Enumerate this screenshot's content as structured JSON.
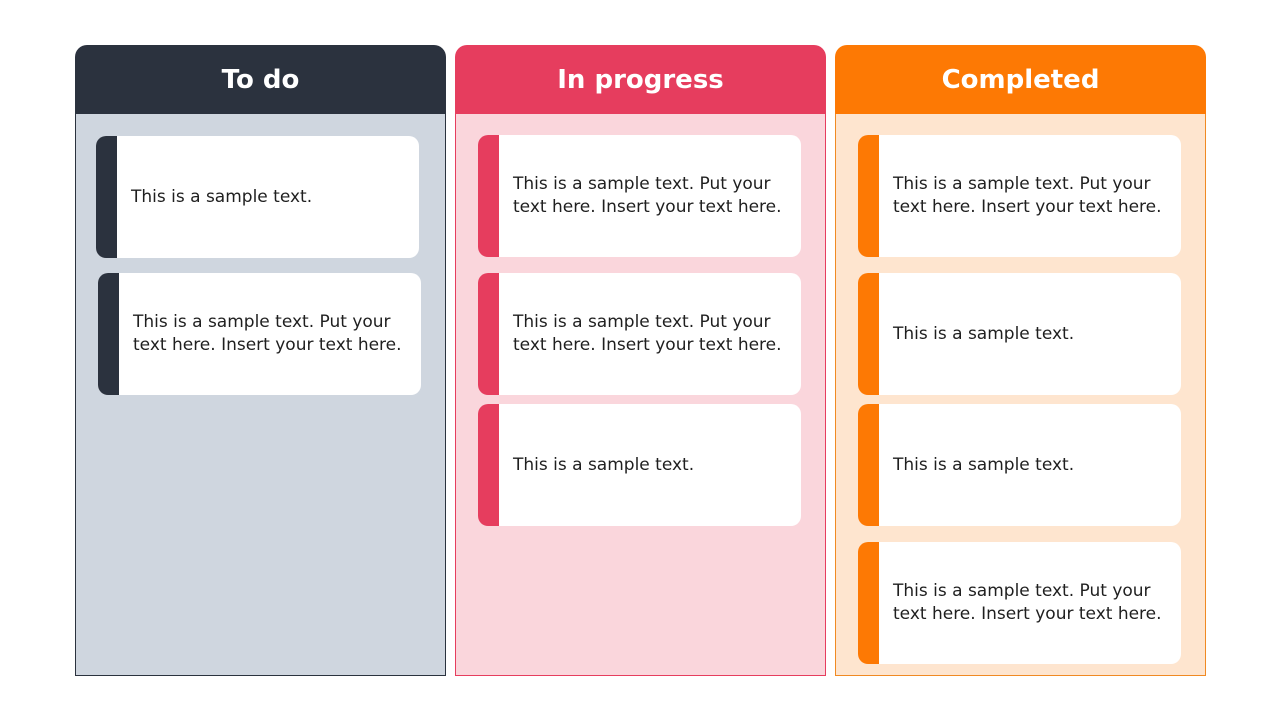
{
  "colors": {
    "todo_header": "#2b323e",
    "todo_body": "#cfd6df",
    "todo_border": "#2b323e",
    "inprogress_header": "#e63d5e",
    "inprogress_body": "#fad6dc",
    "inprogress_border": "#e63d5e",
    "completed_header": "#fd7904",
    "completed_body": "#fee5cf",
    "completed_border": "#f08a23"
  },
  "columns": [
    {
      "title": "To do",
      "cards": [
        {
          "text": "This is a sample text."
        },
        {
          "text": "This is a sample text. Put your text here. Insert your text here."
        }
      ]
    },
    {
      "title": "In progress",
      "cards": [
        {
          "text": "This is a sample text. Put your text here. Insert your text here."
        },
        {
          "text": "This is a sample text. Put your text here. Insert your text here."
        },
        {
          "text": "This is a sample text."
        }
      ]
    },
    {
      "title": "Completed",
      "cards": [
        {
          "text": "This is a sample text. Put your text here. Insert your text here."
        },
        {
          "text": "This is a sample text."
        },
        {
          "text": "This is a sample text."
        },
        {
          "text": "This is a sample text. Put your text here. Insert your text here."
        }
      ]
    }
  ]
}
